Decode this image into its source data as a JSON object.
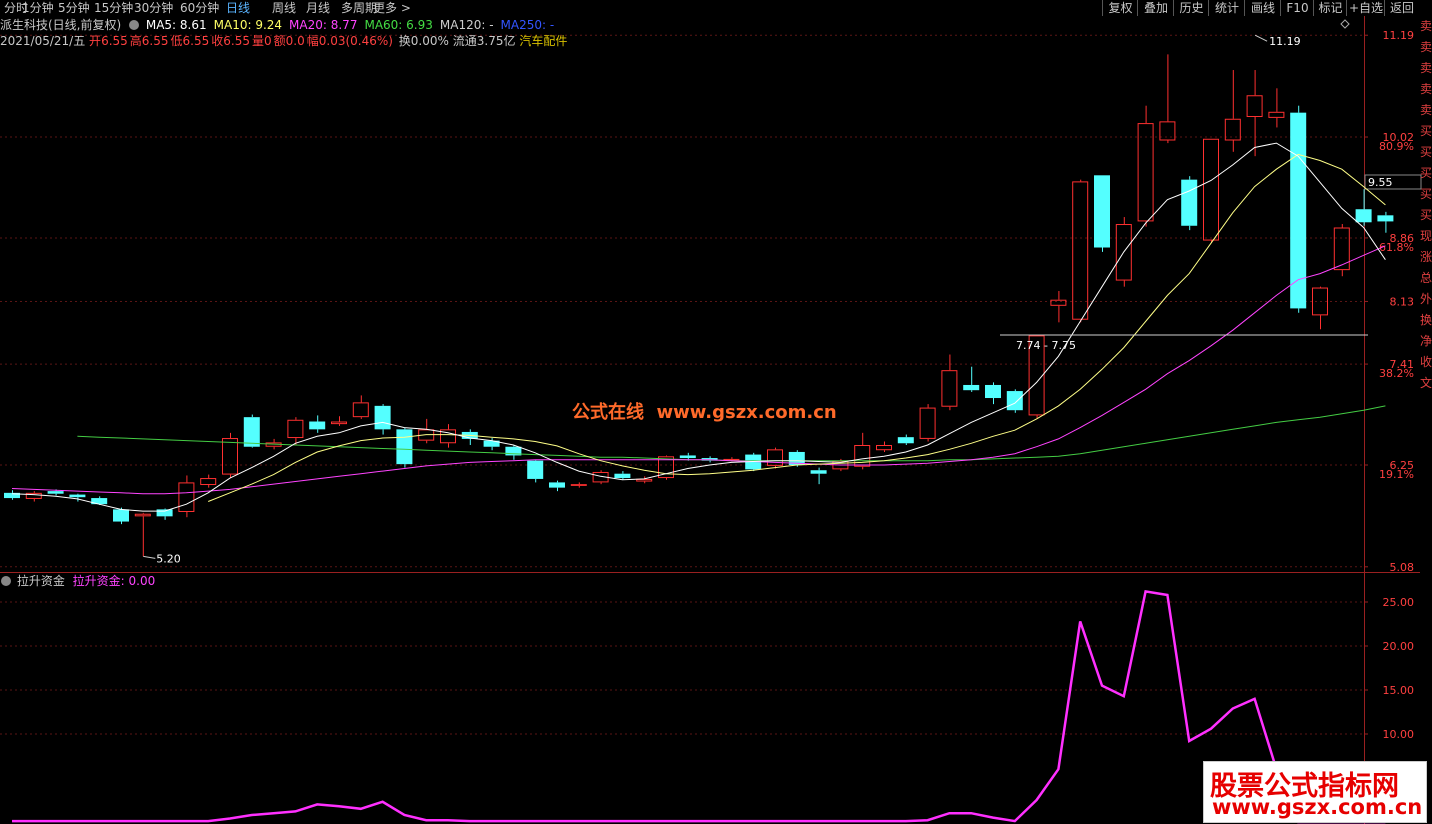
{
  "toolbar": {
    "periods": [
      "分时",
      "1分钟",
      "5分钟",
      "15分钟",
      "30分钟",
      "60分钟",
      "日线",
      "周线",
      "月线",
      "多周期",
      "更多 >"
    ],
    "active_period": "日线",
    "actions": [
      "复权",
      "叠加",
      "历史",
      "统计",
      "画线",
      "F10",
      "标记",
      "+自选",
      "返回"
    ]
  },
  "header": {
    "title": "派生科技(日线,前复权)",
    "ma": [
      {
        "label": "MA5: 8.61",
        "color": "#ffffff"
      },
      {
        "label": "MA10: 9.24",
        "color": "#ffff66"
      },
      {
        "label": "MA20: 8.77",
        "color": "#ff44ff"
      },
      {
        "label": "MA60: 6.93",
        "color": "#44dd44"
      },
      {
        "label": "MA120: -",
        "color": "#cccccc"
      },
      {
        "label": "MA250: -",
        "color": "#3355ff"
      }
    ],
    "date": "2021/05/21/五",
    "quote": [
      {
        "label": "开",
        "value": "6.55"
      },
      {
        "label": "高",
        "value": "6.55"
      },
      {
        "label": "低",
        "value": "6.55"
      },
      {
        "label": "收",
        "value": "6.55"
      },
      {
        "label": "量",
        "value": "0"
      },
      {
        "label": "额",
        "value": "0.0"
      },
      {
        "label": "幅",
        "value": "0.03(0.46%)"
      }
    ],
    "turnover": "换0.00%",
    "float": "流通3.75亿",
    "sector": "汽车配件"
  },
  "price_axis": {
    "ticks": [
      "11.19",
      "10.02",
      "8.86",
      "8.13",
      "7.41",
      "6.25",
      "5.08"
    ],
    "fib": [
      "80.9%",
      "61.8%",
      "38.2%",
      "19.1%"
    ],
    "current": "9.55"
  },
  "annotations": {
    "high": "11.19",
    "low": "5.20",
    "gap": "7.74 - 7.75"
  },
  "right_strip": [
    "卖",
    "卖",
    "卖",
    "卖",
    "卖",
    "买",
    "买",
    "买",
    "买",
    "买",
    "现",
    "涨",
    "总",
    "外",
    "换",
    "净",
    "收",
    "文"
  ],
  "indicator": {
    "name": "拉升资金",
    "value_label": "拉升资金: 0.00",
    "ticks": [
      "25.00",
      "20.00",
      "15.00",
      "10.00"
    ]
  },
  "chart_data": {
    "type": "candlestick",
    "candles": [
      {
        "o": 5.93,
        "c": 5.87,
        "h": 5.96,
        "l": 5.85
      },
      {
        "o": 5.86,
        "c": 5.93,
        "h": 5.95,
        "l": 5.83
      },
      {
        "o": 5.95,
        "c": 5.92,
        "h": 5.97,
        "l": 5.9
      },
      {
        "o": 5.91,
        "c": 5.88,
        "h": 5.92,
        "l": 5.83
      },
      {
        "o": 5.87,
        "c": 5.8,
        "h": 5.89,
        "l": 5.79
      },
      {
        "o": 5.74,
        "c": 5.6,
        "h": 5.76,
        "l": 5.57
      },
      {
        "o": 5.66,
        "c": 5.69,
        "h": 5.7,
        "l": 5.2
      },
      {
        "o": 5.74,
        "c": 5.66,
        "h": 5.75,
        "l": 5.62
      },
      {
        "o": 5.71,
        "c": 6.05,
        "h": 6.13,
        "l": 5.65
      },
      {
        "o": 6.02,
        "c": 6.1,
        "h": 6.14,
        "l": 5.99
      },
      {
        "o": 6.14,
        "c": 6.56,
        "h": 6.62,
        "l": 6.1
      },
      {
        "o": 6.8,
        "c": 6.46,
        "h": 6.83,
        "l": 6.45
      },
      {
        "o": 6.46,
        "c": 6.51,
        "h": 6.55,
        "l": 6.43
      },
      {
        "o": 6.56,
        "c": 6.77,
        "h": 6.8,
        "l": 6.48
      },
      {
        "o": 6.75,
        "c": 6.66,
        "h": 6.82,
        "l": 6.62
      },
      {
        "o": 6.72,
        "c": 6.75,
        "h": 6.81,
        "l": 6.7
      },
      {
        "o": 6.8,
        "c": 6.97,
        "h": 7.05,
        "l": 6.78
      },
      {
        "o": 6.93,
        "c": 6.66,
        "h": 6.95,
        "l": 6.6
      },
      {
        "o": 6.66,
        "c": 6.26,
        "h": 6.68,
        "l": 6.22
      },
      {
        "o": 6.53,
        "c": 6.66,
        "h": 6.78,
        "l": 6.5
      },
      {
        "o": 6.5,
        "c": 6.66,
        "h": 6.72,
        "l": 6.45
      },
      {
        "o": 6.63,
        "c": 6.55,
        "h": 6.66,
        "l": 6.48
      },
      {
        "o": 6.53,
        "c": 6.46,
        "h": 6.56,
        "l": 6.42
      },
      {
        "o": 6.46,
        "c": 6.36,
        "h": 6.48,
        "l": 6.31
      },
      {
        "o": 6.3,
        "c": 6.09,
        "h": 6.31,
        "l": 6.05
      },
      {
        "o": 6.05,
        "c": 5.99,
        "h": 6.07,
        "l": 5.95
      },
      {
        "o": 6.01,
        "c": 6.03,
        "h": 6.05,
        "l": 5.99
      },
      {
        "o": 6.05,
        "c": 6.17,
        "h": 6.19,
        "l": 6.03
      },
      {
        "o": 6.15,
        "c": 6.1,
        "h": 6.18,
        "l": 6.08
      },
      {
        "o": 6.06,
        "c": 6.09,
        "h": 6.12,
        "l": 6.04
      },
      {
        "o": 6.1,
        "c": 6.35,
        "h": 6.36,
        "l": 6.08
      },
      {
        "o": 6.36,
        "c": 6.33,
        "h": 6.39,
        "l": 6.3
      },
      {
        "o": 6.33,
        "c": 6.3,
        "h": 6.35,
        "l": 6.28
      },
      {
        "o": 6.31,
        "c": 6.32,
        "h": 6.34,
        "l": 6.29
      },
      {
        "o": 6.37,
        "c": 6.2,
        "h": 6.39,
        "l": 6.18
      },
      {
        "o": 6.24,
        "c": 6.43,
        "h": 6.45,
        "l": 6.21
      },
      {
        "o": 6.4,
        "c": 6.25,
        "h": 6.42,
        "l": 6.23
      },
      {
        "o": 6.19,
        "c": 6.15,
        "h": 6.22,
        "l": 6.03
      },
      {
        "o": 6.2,
        "c": 6.3,
        "h": 6.32,
        "l": 6.18
      },
      {
        "o": 6.23,
        "c": 6.48,
        "h": 6.62,
        "l": 6.2
      },
      {
        "o": 6.42,
        "c": 6.48,
        "h": 6.52,
        "l": 6.4
      },
      {
        "o": 6.57,
        "c": 6.5,
        "h": 6.6,
        "l": 6.48
      },
      {
        "o": 6.55,
        "c": 6.91,
        "h": 6.95,
        "l": 6.52
      },
      {
        "o": 6.92,
        "c": 7.34,
        "h": 7.52,
        "l": 6.88
      },
      {
        "o": 7.17,
        "c": 7.11,
        "h": 7.38,
        "l": 7.09
      },
      {
        "o": 7.17,
        "c": 7.02,
        "h": 7.2,
        "l": 6.95
      },
      {
        "o": 7.1,
        "c": 6.88,
        "h": 7.12,
        "l": 6.85
      },
      {
        "o": 6.82,
        "c": 7.74,
        "h": 7.75,
        "l": 6.78
      },
      {
        "o": 8.08,
        "c": 8.15,
        "h": 8.25,
        "l": 7.89
      },
      {
        "o": 7.92,
        "c": 9.51,
        "h": 9.53,
        "l": 7.89
      },
      {
        "o": 9.58,
        "c": 8.75,
        "h": 9.58,
        "l": 8.7
      },
      {
        "o": 8.37,
        "c": 9.02,
        "h": 9.1,
        "l": 8.3
      },
      {
        "o": 9.05,
        "c": 10.18,
        "h": 10.38,
        "l": 8.99
      },
      {
        "o": 9.98,
        "c": 10.2,
        "h": 10.97,
        "l": 9.95
      },
      {
        "o": 9.53,
        "c": 9.0,
        "h": 9.57,
        "l": 8.95
      },
      {
        "o": 8.83,
        "c": 10.0,
        "h": 10.0,
        "l": 8.8
      },
      {
        "o": 9.98,
        "c": 10.23,
        "h": 10.79,
        "l": 9.85
      },
      {
        "o": 10.25,
        "c": 10.5,
        "h": 10.79,
        "l": 9.8
      },
      {
        "o": 10.24,
        "c": 10.31,
        "h": 10.58,
        "l": 10.13
      },
      {
        "o": 10.3,
        "c": 8.05,
        "h": 10.38,
        "l": 8.0
      },
      {
        "o": 7.97,
        "c": 8.29,
        "h": 8.3,
        "l": 7.81
      },
      {
        "o": 8.49,
        "c": 8.98,
        "h": 9.02,
        "l": 8.42
      },
      {
        "o": 9.19,
        "c": 9.04,
        "h": 9.42,
        "l": 9.0
      },
      {
        "o": 9.12,
        "c": 9.05,
        "h": 9.16,
        "l": 8.92
      }
    ],
    "ma5": [
      5.92,
      5.91,
      5.89,
      5.86,
      5.8,
      5.74,
      5.72,
      5.72,
      5.8,
      5.93,
      6.1,
      6.22,
      6.35,
      6.5,
      6.58,
      6.62,
      6.7,
      6.74,
      6.68,
      6.66,
      6.62,
      6.56,
      6.53,
      6.48,
      6.39,
      6.28,
      6.18,
      6.12,
      6.08,
      6.09,
      6.15,
      6.21,
      6.25,
      6.28,
      6.29,
      6.3,
      6.3,
      6.29,
      6.28,
      6.32,
      6.35,
      6.4,
      6.48,
      6.61,
      6.74,
      6.85,
      6.96,
      7.2,
      7.5,
      7.9,
      8.3,
      8.7,
      9.03,
      9.3,
      9.4,
      9.52,
      9.7,
      9.9,
      9.95,
      9.8,
      9.5,
      9.2,
      8.98,
      8.61
    ],
    "ma10": [
      null,
      null,
      null,
      null,
      null,
      null,
      null,
      null,
      null,
      5.83,
      5.93,
      6.03,
      6.14,
      6.28,
      6.4,
      6.47,
      6.53,
      6.56,
      6.57,
      6.6,
      6.6,
      6.59,
      6.57,
      6.55,
      6.52,
      6.47,
      6.38,
      6.3,
      6.24,
      6.19,
      6.15,
      6.14,
      6.15,
      6.17,
      6.19,
      6.22,
      6.25,
      6.26,
      6.27,
      6.28,
      6.3,
      6.33,
      6.37,
      6.43,
      6.5,
      6.58,
      6.65,
      6.78,
      6.93,
      7.12,
      7.35,
      7.6,
      7.9,
      8.2,
      8.45,
      8.8,
      9.15,
      9.45,
      9.65,
      9.82,
      9.75,
      9.65,
      9.45,
      9.24
    ],
    "ma20": [
      5.98,
      5.97,
      5.96,
      5.95,
      5.94,
      5.93,
      5.92,
      5.92,
      5.93,
      5.95,
      5.97,
      6.0,
      6.03,
      6.06,
      6.09,
      6.12,
      6.15,
      6.18,
      6.21,
      6.24,
      6.26,
      6.28,
      6.29,
      6.3,
      6.31,
      6.31,
      6.31,
      6.31,
      6.31,
      6.31,
      6.31,
      6.31,
      6.31,
      6.3,
      6.29,
      6.28,
      6.27,
      6.26,
      6.25,
      6.25,
      6.25,
      6.26,
      6.27,
      6.29,
      6.31,
      6.34,
      6.38,
      6.46,
      6.55,
      6.68,
      6.82,
      6.97,
      7.12,
      7.3,
      7.45,
      7.62,
      7.8,
      8.0,
      8.2,
      8.38,
      8.45,
      8.55,
      8.66,
      8.77
    ],
    "ma60": [
      null,
      null,
      null,
      6.58,
      6.57,
      6.56,
      6.55,
      6.54,
      6.53,
      6.52,
      6.51,
      6.5,
      6.49,
      6.48,
      6.47,
      6.46,
      6.45,
      6.44,
      6.43,
      6.42,
      6.41,
      6.4,
      6.39,
      6.38,
      6.37,
      6.36,
      6.35,
      6.34,
      6.34,
      6.33,
      6.32,
      6.31,
      6.31,
      6.3,
      6.3,
      6.3,
      6.3,
      6.3,
      6.3,
      6.3,
      6.3,
      6.3,
      6.3,
      6.31,
      6.31,
      6.32,
      6.33,
      6.34,
      6.35,
      6.38,
      6.42,
      6.46,
      6.5,
      6.54,
      6.58,
      6.62,
      6.66,
      6.7,
      6.74,
      6.77,
      6.8,
      6.84,
      6.88,
      6.93
    ],
    "lsfunds": [
      0.1,
      0.1,
      0.1,
      0.1,
      0.1,
      0.1,
      0.1,
      0.1,
      0.1,
      0.1,
      0.4,
      0.8,
      1.0,
      1.2,
      2.0,
      1.8,
      1.5,
      2.3,
      0.8,
      0.2,
      0.2,
      0.1,
      0.1,
      0.1,
      0.1,
      0.1,
      0.1,
      0.1,
      0.1,
      0.1,
      0.1,
      0.1,
      0.1,
      0.1,
      0.1,
      0.1,
      0.1,
      0.1,
      0.1,
      0.1,
      0.1,
      0.1,
      0.2,
      1.0,
      1.0,
      0.5,
      0.1,
      2.5,
      6.0,
      22.8,
      15.5,
      14.3,
      26.2,
      25.8,
      9.2,
      10.6,
      12.9,
      14.0,
      6.0,
      0.0,
      0.0,
      0.0,
      0.0,
      0.0
    ],
    "ylim": [
      5.08,
      11.19
    ],
    "sub_ylim": [
      0,
      27
    ]
  }
}
